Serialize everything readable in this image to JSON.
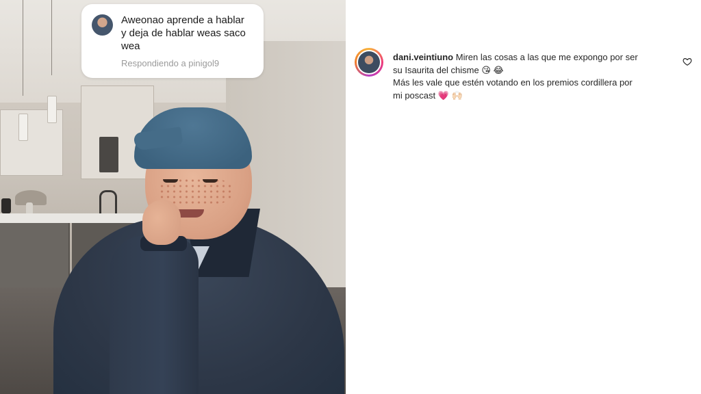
{
  "reply": {
    "text": "Aweonao aprende a hablar\ny deja de hablar weas saco\nwea",
    "subtext": "Respondiendo a pinigol9"
  },
  "comment": {
    "username": "dani.veintiuno",
    "line1": "Miren las cosas a las que me expongo por ser",
    "line2": "su Isaurita del chisme 😘 😂",
    "line3": "Más les vale que estén votando en los premios cordillera por",
    "line4": "mi poscast 💗 🙌🏻"
  },
  "icons": {
    "like": "heart-outline-icon"
  }
}
